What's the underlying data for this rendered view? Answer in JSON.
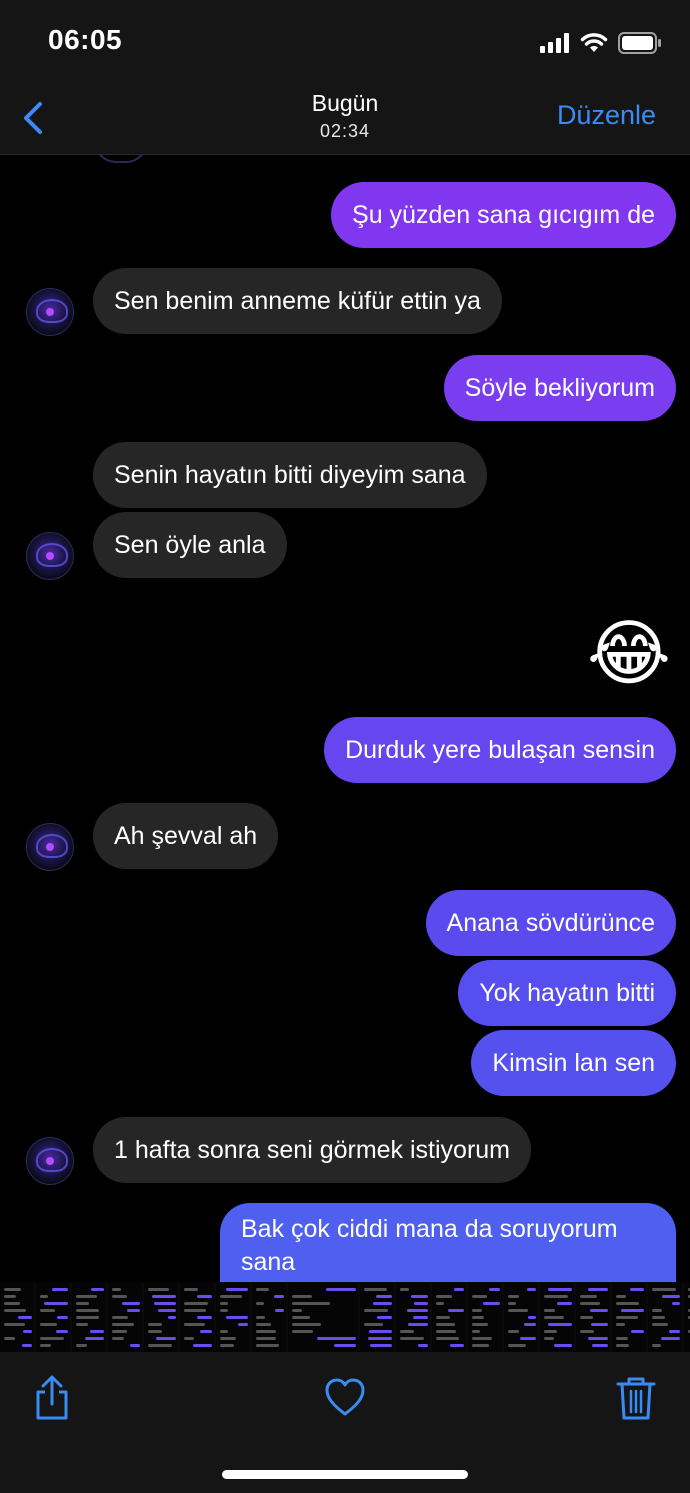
{
  "status": {
    "time": "06:05"
  },
  "nav": {
    "title": "Bugün",
    "subtitle": "02:34",
    "edit": "Düzenle"
  },
  "colors": {
    "accent": "#3b8bf5",
    "incoming": "#262626",
    "outgoing_top": "#8a3df0",
    "outgoing_bottom": "#4f5ff0"
  },
  "messages": [
    {
      "dir": "out",
      "text": "Şu yüzden sana gıcıgım de"
    },
    {
      "dir": "in",
      "text": "Sen benim anneme küfür ettin ya"
    },
    {
      "dir": "out",
      "text": "Söyle bekliyorum"
    },
    {
      "dir": "in",
      "text": "Senin hayatın bitti diyeyim sana"
    },
    {
      "dir": "in",
      "text": "Sen öyle anla"
    },
    {
      "dir": "out",
      "text": "😂"
    },
    {
      "dir": "out",
      "text": "Durduk yere bulaşan sensin"
    },
    {
      "dir": "in",
      "text": "Ah şevval ah"
    },
    {
      "dir": "out",
      "text": "Anana sövdürünce"
    },
    {
      "dir": "out",
      "text": "Yok hayatın bitti"
    },
    {
      "dir": "out",
      "text": "Kimsin lan sen"
    },
    {
      "dir": "in",
      "text": "1 hafta sonra seni görmek istiyorum"
    },
    {
      "dir": "out",
      "text": "Bak çok ciddi mana da soruyorum sana"
    }
  ],
  "toolbar": {
    "share": "share-icon",
    "favorite": "heart-icon",
    "delete": "trash-icon"
  }
}
